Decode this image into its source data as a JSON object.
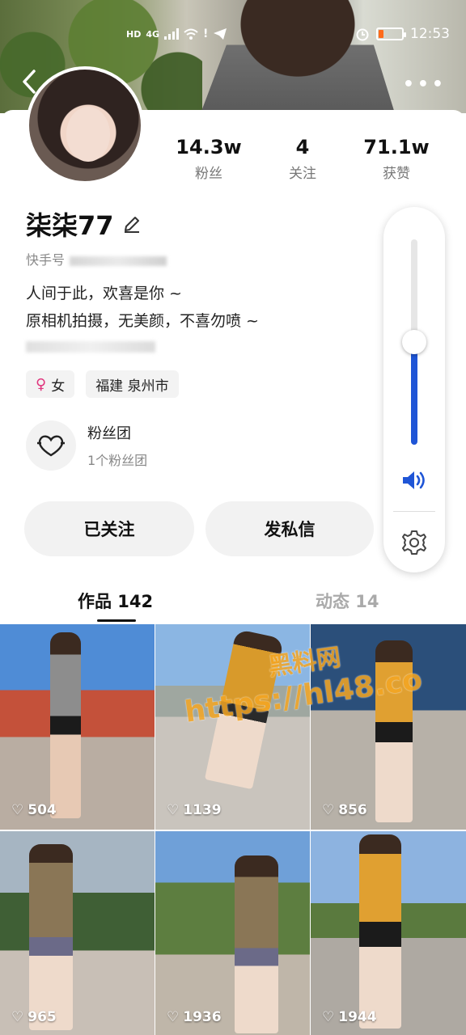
{
  "statusbar": {
    "hd": "HD",
    "net": "4G",
    "time": "12:53"
  },
  "profile": {
    "stats": [
      {
        "value": "14.3w",
        "label": "粉丝"
      },
      {
        "value": "4",
        "label": "关注"
      },
      {
        "value": "71.1w",
        "label": "获赞"
      }
    ],
    "name": "柒柒77",
    "kuaishou_id_label": "快手号",
    "bio": [
      "人间于此，欢喜是你 ~",
      "原相机拍摄，无美颜，不喜勿喷 ~"
    ],
    "tags": {
      "gender": "女",
      "location": "福建 泉州市"
    },
    "fan_club": {
      "title": "粉丝团",
      "subtitle": "1个粉丝团"
    },
    "buttons": {
      "follow": "已关注",
      "message": "发私信"
    }
  },
  "volume_panel": {
    "level_fraction": 0.5
  },
  "tabs": {
    "works": "作品 142",
    "feed": "动态 14"
  },
  "grid": [
    {
      "likes": "504"
    },
    {
      "likes": "1139"
    },
    {
      "likes": "856"
    },
    {
      "likes": "965"
    },
    {
      "likes": "1936"
    },
    {
      "likes": "1944"
    }
  ],
  "watermark": {
    "line1": "黑料网",
    "line2": "https://hl48.co"
  },
  "colors": {
    "accent_blue": "#1f55d6",
    "female_pink": "#e0357d",
    "watermark_orange": "#f5a623"
  }
}
